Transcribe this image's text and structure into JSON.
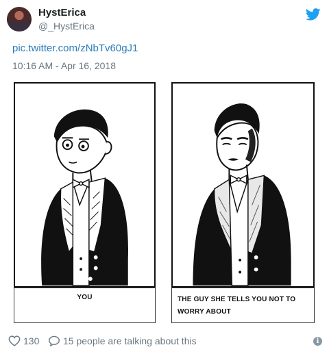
{
  "tweet": {
    "author_name": "HystErica",
    "author_handle": "@_HystErica",
    "link_text": "pic.twitter.com/zNbTv60gJ1",
    "timestamp": "10:16 AM - Apr 16, 2018"
  },
  "comic": {
    "left_caption": "YOU",
    "right_caption": "THE GUY SHE TELLS YOU NOT TO WORRY ABOUT"
  },
  "footer": {
    "likes_count": "130",
    "talking_text": "15 people are talking about this",
    "info_glyph": "i"
  },
  "icons": {
    "brand": "twitter-bird-icon",
    "like": "heart-icon",
    "reply": "comment-icon",
    "info": "info-icon"
  },
  "colors": {
    "link": "#2b7bb9",
    "muted": "#697882",
    "brand": "#1da1f2"
  }
}
